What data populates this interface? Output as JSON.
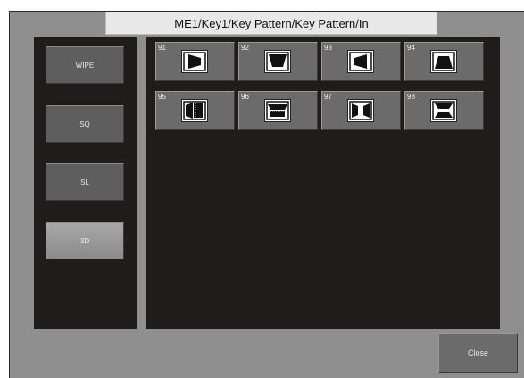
{
  "title": "ME1/Key1/Key Pattern/Key Pattern/In",
  "categories": [
    {
      "label": "WIPE",
      "selected": false
    },
    {
      "label": "SQ",
      "selected": false
    },
    {
      "label": "SL",
      "selected": false
    },
    {
      "label": "3D",
      "selected": true
    }
  ],
  "patterns": [
    {
      "number": "91",
      "icon": "door-right-icon"
    },
    {
      "number": "92",
      "icon": "flip-top-icon"
    },
    {
      "number": "93",
      "icon": "door-left-icon"
    },
    {
      "number": "94",
      "icon": "flip-bottom-icon"
    },
    {
      "number": "95",
      "icon": "book-left-icon"
    },
    {
      "number": "96",
      "icon": "book-top-icon"
    },
    {
      "number": "97",
      "icon": "double-door-icon"
    },
    {
      "number": "98",
      "icon": "double-flip-icon"
    }
  ],
  "close_label": "Close"
}
